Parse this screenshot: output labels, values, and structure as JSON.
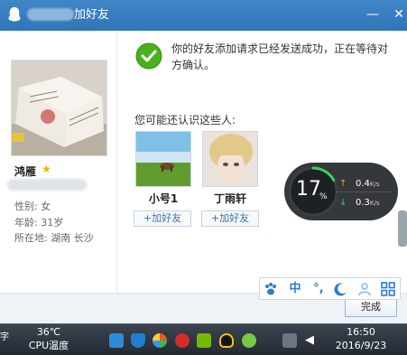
{
  "window": {
    "title": "加好友",
    "minimize_glyph": "—",
    "close_glyph": "✕"
  },
  "profile": {
    "nickname": "鸿雁",
    "gender": "性别: 女",
    "age": "年龄: 31岁",
    "location": "所在地: 湖南  长沙"
  },
  "message": "你的好友添加请求已经发送成功，正在等待对方确认。",
  "suggest": {
    "title": "您可能还认识这些人:",
    "people": [
      {
        "name": "小号1",
        "add_label": "+加好友"
      },
      {
        "name": "丁雨轩",
        "add_label": "+加好友"
      }
    ]
  },
  "monitor": {
    "percent": "17",
    "percent_sign": "%",
    "upload": "0.4",
    "download": "0.3",
    "unit": "K/s",
    "up_arrow": "↑",
    "down_arrow": "↓",
    "percent_value": 17
  },
  "ime": {
    "items": [
      "paw-icon",
      "中",
      "°,",
      "moon-icon",
      "person-icon",
      "grid-icon"
    ],
    "lang": "中",
    "punct": "°,"
  },
  "done_button": "完成",
  "taskbar": {
    "edge_text": "字",
    "temperature": "36℃",
    "temperature_label": "CPU温度",
    "time": "16:50",
    "date": "2016/9/23",
    "tray_icons": [
      "box-icon",
      "shield-icon",
      "pinwheel-icon",
      "netease-icon",
      "nvidia-icon",
      "penguin-icon",
      "plus-shield-icon",
      "network-icon",
      "volume-icon"
    ]
  },
  "colors": {
    "title_bar": "#3f86c7",
    "success_green": "#4caf1e",
    "link_blue": "#3c6fa8",
    "star": "#e8b400",
    "gauge_green": "#3ecf5b"
  }
}
